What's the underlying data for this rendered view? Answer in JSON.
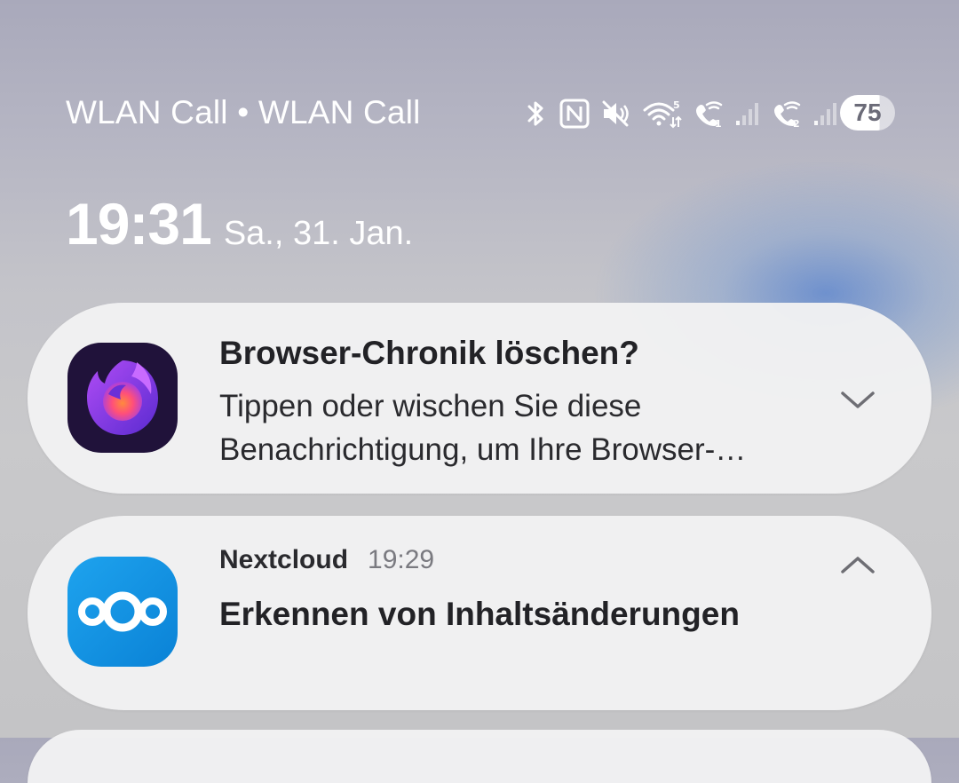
{
  "status_bar": {
    "carrier": "WLAN Call • WLAN Call",
    "icons": [
      "bluetooth-icon",
      "nfc-icon",
      "mute-icon",
      "wifi-icon",
      "wifi-call-1-icon",
      "signal-1-icon",
      "wifi-call-2-icon",
      "signal-2-icon"
    ],
    "wifi_badge": "5",
    "sim1_badge": "1",
    "sim2_badge": "2",
    "battery_level": "75"
  },
  "lockscreen": {
    "time": "19:31",
    "date": "Sa., 31. Jan."
  },
  "notifications": [
    {
      "app_icon": "firefox-focus-icon",
      "title": "Browser-Chronik löschen?",
      "body": "Tippen oder wischen Sie diese Benachrichtigung, um Ihre Browser-…",
      "expanded": false
    },
    {
      "app_icon": "nextcloud-icon",
      "app_name": "Nextcloud",
      "time": "19:29",
      "title": "Erkennen von Inhaltsänderungen",
      "expanded": true
    }
  ],
  "colors": {
    "card_background": "#f1f1f2",
    "text_primary": "#222226",
    "text_secondary": "#7a7a80",
    "status_text": "#ffffff"
  }
}
